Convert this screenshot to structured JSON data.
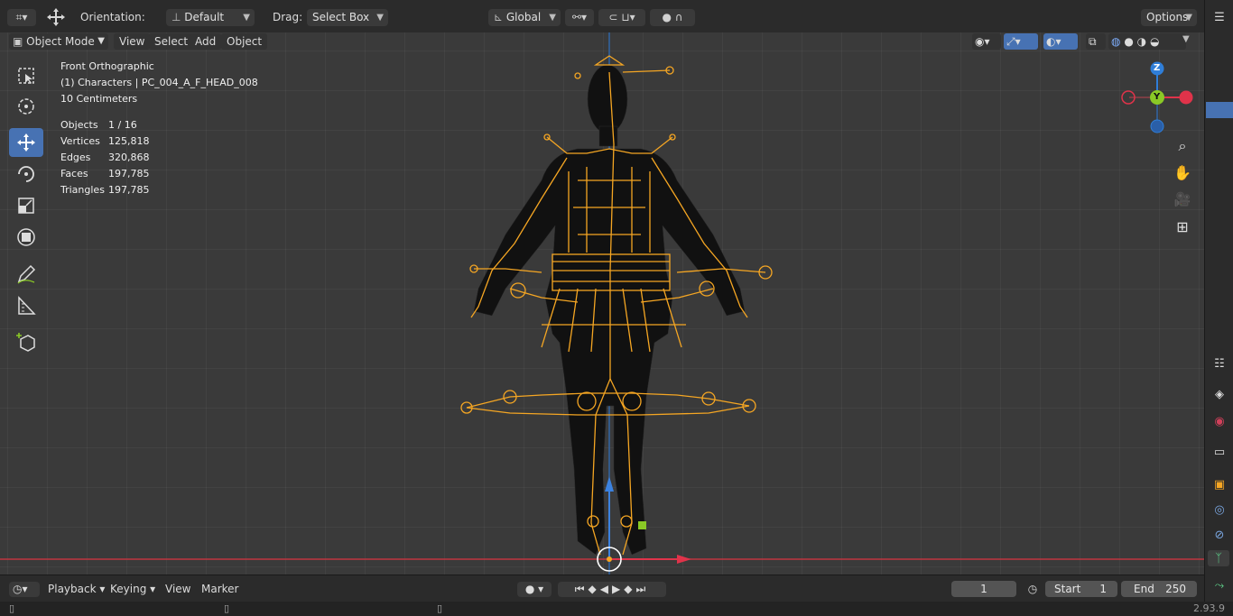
{
  "header": {
    "orientation_label": "Orientation:",
    "orientation_value": "Default",
    "drag_label": "Drag:",
    "drag_value": "Select Box",
    "transform_space": "Global",
    "options_label": "Options"
  },
  "viewport_header": {
    "mode": "Object Mode",
    "menus": [
      "View",
      "Select",
      "Add",
      "Object"
    ]
  },
  "overlay": {
    "view_name": "Front Orthographic",
    "collection_object": "(1) Characters | PC_004_A_F_HEAD_008",
    "grid_scale": "10 Centimeters",
    "stats": [
      {
        "label": "Objects",
        "value": "1 / 16"
      },
      {
        "label": "Vertices",
        "value": "125,818"
      },
      {
        "label": "Edges",
        "value": "320,868"
      },
      {
        "label": "Faces",
        "value": "197,785"
      },
      {
        "label": "Triangles",
        "value": "197,785"
      }
    ]
  },
  "gizmo": {
    "z": "Z",
    "y": "Y",
    "x_neg": "",
    "x": ""
  },
  "toolbar": {
    "tools": [
      "select-box",
      "cursor",
      "move",
      "rotate",
      "scale",
      "transform",
      "annotate",
      "measure",
      "add-cube"
    ],
    "active_tool": "move"
  },
  "timeline": {
    "menus": [
      "Playback",
      "Keying",
      "View",
      "Marker"
    ],
    "current_frame": "1",
    "start_label": "Start",
    "start_value": "1",
    "end_label": "End",
    "end_value": "250"
  },
  "status": {
    "version": "2.93.9"
  },
  "colors": {
    "accent": "#4772b3",
    "armature": "#f5a623",
    "x_axis": "#e0334a",
    "y_axis": "#8ac926",
    "z_axis": "#2f7ed8"
  }
}
